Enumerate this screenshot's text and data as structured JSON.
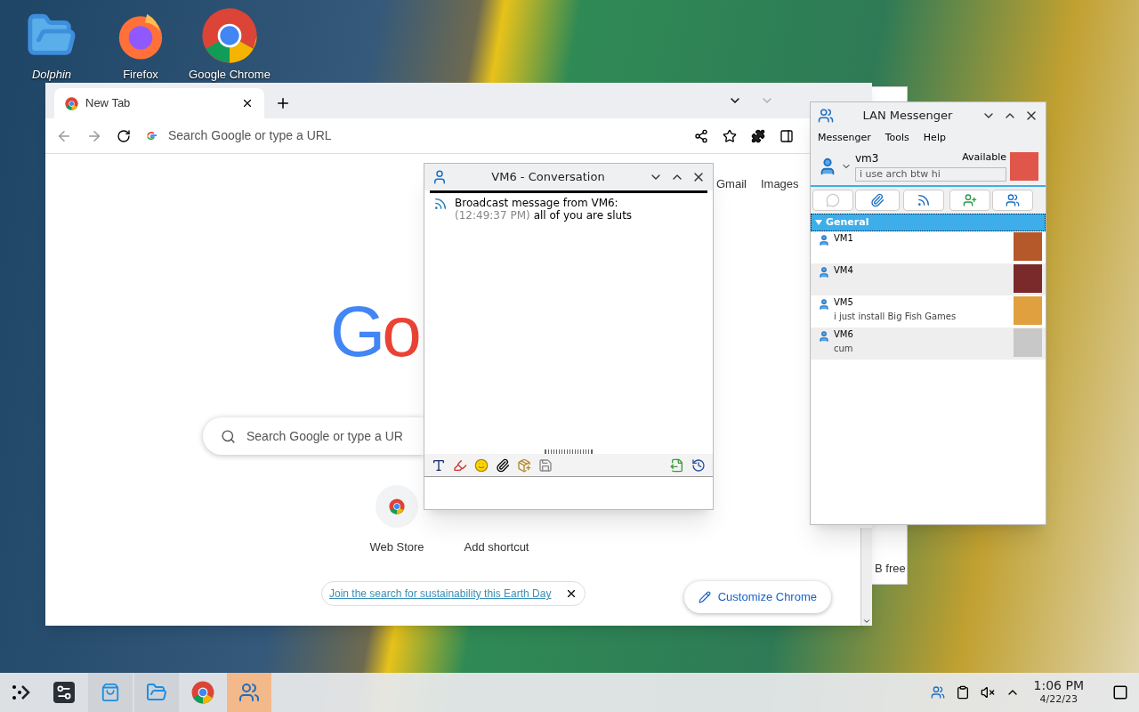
{
  "desktop_icons": [
    {
      "kind": "folder",
      "label": "Dolphin"
    },
    {
      "kind": "firefox",
      "label": "Firefox"
    },
    {
      "kind": "chrome",
      "label": "Google Chrome"
    }
  ],
  "back_window": {
    "text": "B free"
  },
  "chrome": {
    "tab": {
      "title": "New Tab",
      "selected": true
    },
    "omnibox": {
      "placeholder": "Search Google or type a URL"
    },
    "links": [
      "Gmail",
      "Images"
    ],
    "logo": "Go",
    "search": {
      "placeholder": "Search Google or type a UR"
    },
    "shortcuts": [
      {
        "kind": "store",
        "label": "Web Store"
      },
      {
        "kind": "add",
        "label": "Add shortcut"
      }
    ],
    "promo": "Join the search for sustainability this Earth Day",
    "customize": "Customize Chrome"
  },
  "conversation": {
    "title": "VM6 - Conversation",
    "messages": [
      {
        "header": "Broadcast message from VM6:",
        "time": "(12:49:37 PM)",
        "text": "all of you are sluts"
      }
    ]
  },
  "messenger": {
    "title": "LAN Messenger",
    "menu": [
      "Messenger",
      "Tools",
      "Help"
    ],
    "user": {
      "name": "vm3",
      "status": "Available",
      "note": "i use arch btw hi"
    },
    "groups": [
      {
        "name": "General",
        "expanded": true,
        "contacts": [
          {
            "name": "VM1",
            "color": "#b5582a"
          },
          {
            "name": "VM4",
            "color": "#7a2a2a"
          },
          {
            "name": "VM5",
            "note": "i just install Big Fish Games",
            "color": "#e0a040"
          },
          {
            "name": "VM6",
            "note": "cum",
            "color": "#c8c8c8"
          }
        ]
      }
    ]
  },
  "taskbar": {
    "apps": [
      {
        "kind": "settings",
        "selected": false
      },
      {
        "kind": "store",
        "selected": false
      },
      {
        "kind": "folder",
        "selected": false
      },
      {
        "kind": "chrome",
        "selected": false
      },
      {
        "kind": "messenger",
        "selected": true
      }
    ],
    "time": "1:06 PM",
    "date": "4/22/23"
  }
}
